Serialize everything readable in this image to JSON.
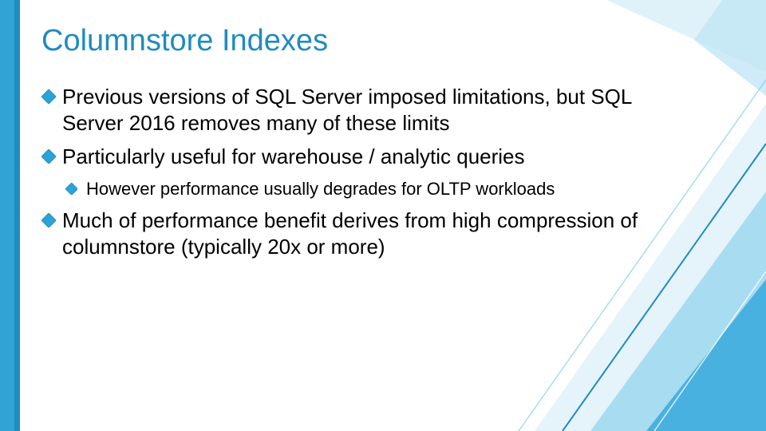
{
  "title": "Columnstore Indexes",
  "bullets": {
    "b1": "Previous versions of SQL Server imposed limitations, but SQL Server 2016 removes many of these limits",
    "b2": "Particularly useful for warehouse / analytic queries",
    "b2a": "However performance usually degrades for OLTP workloads",
    "b3": "Much of performance benefit derives from high compression of columnstore (typically 20x or more)"
  },
  "colors": {
    "title": "#1f8bbf",
    "bullet_fill": "#2aa3d9",
    "bullet_stroke": "#1f8bbf"
  }
}
